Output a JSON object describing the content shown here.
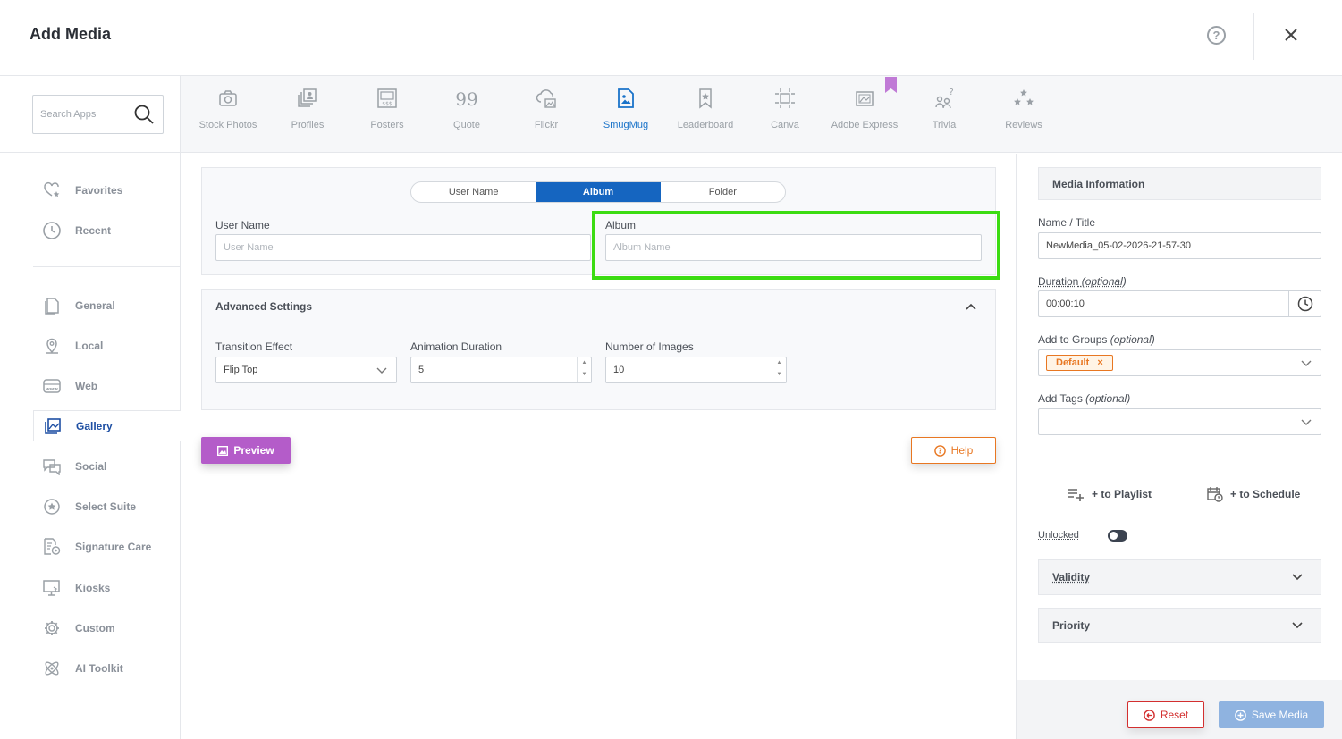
{
  "header": {
    "title": "Add Media",
    "help_symbol": "?"
  },
  "search": {
    "placeholder": "Search Apps"
  },
  "sidebar": {
    "items": [
      {
        "label": "Favorites",
        "icon": "heart-star-icon"
      },
      {
        "label": "Recent",
        "icon": "clock-icon"
      },
      {
        "label": "General",
        "icon": "document-icon"
      },
      {
        "label": "Local",
        "icon": "map-pin-icon"
      },
      {
        "label": "Web",
        "icon": "www-icon"
      },
      {
        "label": "Gallery",
        "icon": "gallery-icon",
        "active": true
      },
      {
        "label": "Social",
        "icon": "chat-icon"
      },
      {
        "label": "Select Suite",
        "icon": "star-circle-icon"
      },
      {
        "label": "Signature Care",
        "icon": "signature-care-icon"
      },
      {
        "label": "Kiosks",
        "icon": "kiosk-icon"
      },
      {
        "label": "Custom",
        "icon": "gear-icon"
      },
      {
        "label": "AI Toolkit",
        "icon": "atom-icon"
      }
    ]
  },
  "apps": [
    {
      "label": "Stock Photos",
      "icon": "camera-icon"
    },
    {
      "label": "Profiles",
      "icon": "profiles-icon"
    },
    {
      "label": "Posters",
      "icon": "poster-icon"
    },
    {
      "label": "Quote",
      "icon": "quote-icon"
    },
    {
      "label": "Flickr",
      "icon": "cloud-image-icon"
    },
    {
      "label": "SmugMug",
      "icon": "smugmug-icon",
      "active": true
    },
    {
      "label": "Leaderboard",
      "icon": "bookmark-star-icon"
    },
    {
      "label": "Canva",
      "icon": "canva-frame-icon"
    },
    {
      "label": "Adobe Express",
      "icon": "image-frame-icon"
    },
    {
      "label": "Trivia",
      "icon": "trivia-icon"
    },
    {
      "label": "Reviews",
      "icon": "stars-icon"
    }
  ],
  "source_tabs": {
    "options": [
      "User Name",
      "Album",
      "Folder"
    ],
    "selected": "Album"
  },
  "form": {
    "username_label": "User Name",
    "username_placeholder": "User Name",
    "album_label": "Album",
    "album_placeholder": "Album Name"
  },
  "advanced": {
    "title": "Advanced Settings",
    "transition_label": "Transition Effect",
    "transition_value": "Flip Top",
    "animation_label": "Animation Duration",
    "animation_value": "5",
    "images_label": "Number of Images",
    "images_value": "10"
  },
  "buttons": {
    "preview": "Preview",
    "help": "Help",
    "reset": "Reset",
    "save": "Save Media"
  },
  "media_info": {
    "title": "Media Information",
    "name_label": "Name / Title",
    "name_value": "NewMedia_05-02-2026-21-57-30",
    "duration_label": "Duration",
    "duration_value": "00:00:10",
    "groups_label": "Add to Groups",
    "group_tag": "Default",
    "tags_label": "Add Tags",
    "optional": "(optional)",
    "to_playlist": "+ to Playlist",
    "to_schedule": "+ to Schedule",
    "unlocked": "Unlocked",
    "validity": "Validity",
    "priority": "Priority"
  },
  "colors": {
    "accent": "#1565c0",
    "preview": "#b45cc9",
    "help": "#e87722",
    "reset": "#d32f2f",
    "save": "#8fb3e0",
    "highlight": "#3cdc12"
  }
}
